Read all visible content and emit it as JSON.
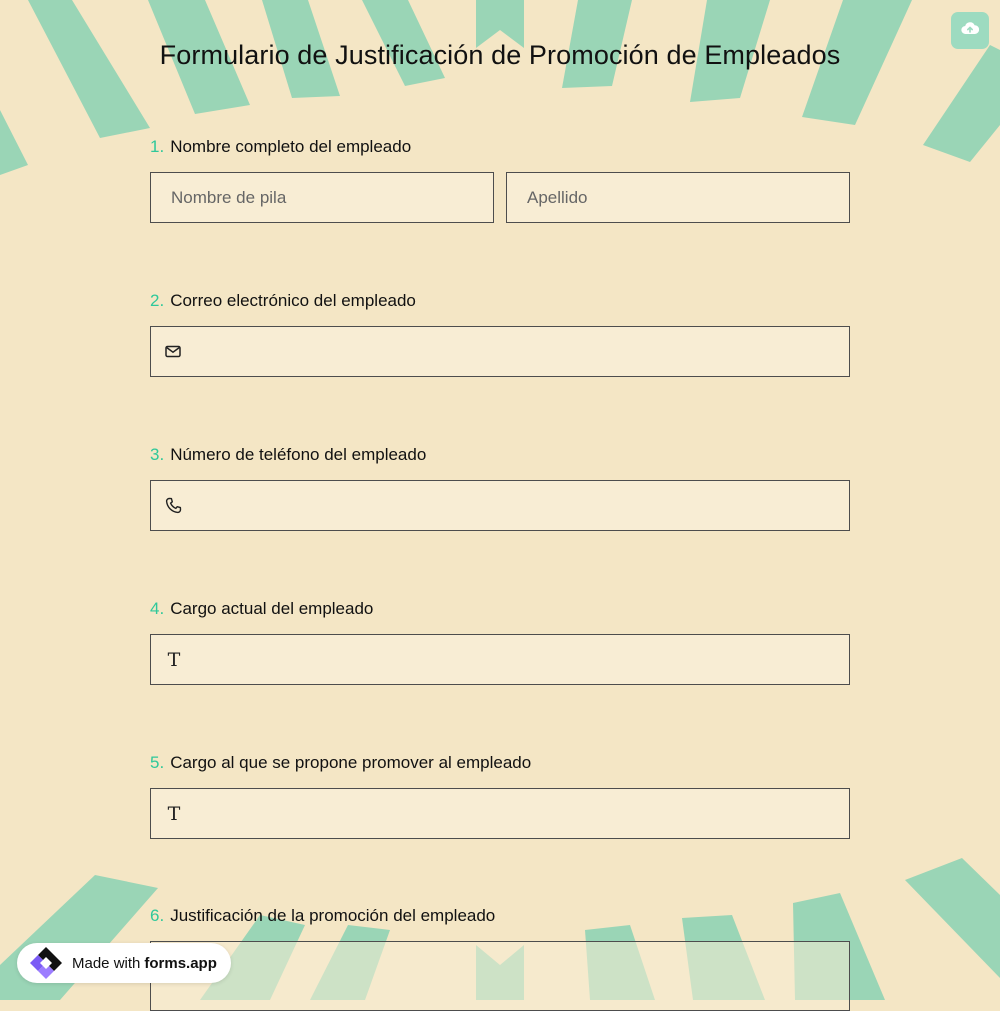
{
  "form": {
    "title": "Formulario de Justificación de Promoción de Empleados"
  },
  "toolbar": {
    "save_icon": "cloud-upload-icon"
  },
  "questions": [
    {
      "number": "1.",
      "label": "Nombre completo del empleado",
      "first_name_placeholder": "Nombre de pila",
      "last_name_placeholder": "Apellido"
    },
    {
      "number": "2.",
      "label": "Correo electrónico del empleado",
      "icon": "mail-icon",
      "value": ""
    },
    {
      "number": "3.",
      "label": "Número de teléfono del empleado",
      "icon": "phone-icon",
      "value": ""
    },
    {
      "number": "4.",
      "label": "Cargo actual del empleado",
      "icon": "text-icon",
      "icon_glyph": "T",
      "value": ""
    },
    {
      "number": "5.",
      "label": "Cargo al que se propone promover al empleado",
      "icon": "text-icon",
      "icon_glyph": "T",
      "value": ""
    },
    {
      "number": "6.",
      "label": "Justificación de la promoción del empleado",
      "value": ""
    }
  ],
  "badge": {
    "prefix": "Made with",
    "brand": "forms.app"
  },
  "colors": {
    "background": "#f4e6c5",
    "stripes": "#9ad5b6",
    "accent_number": "#2fc89a",
    "field_background": "#f8edd4",
    "save_button": "#9ddbc0"
  }
}
